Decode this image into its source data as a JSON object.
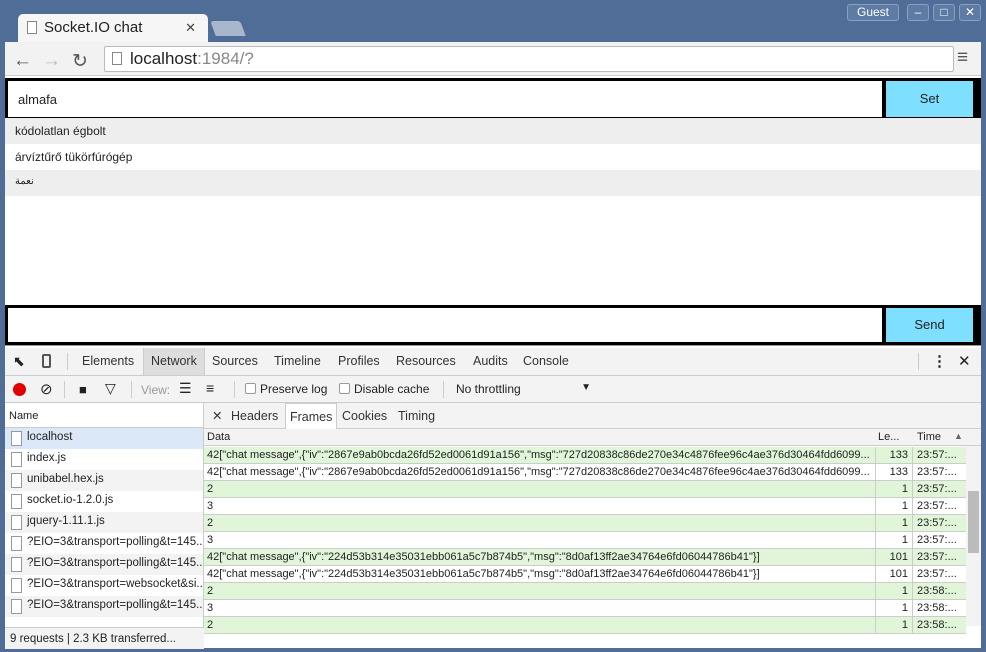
{
  "browser": {
    "tab_title": "Socket.IO chat",
    "profile": "Guest",
    "url_host": "localhost",
    "url_rest": ":1984/?"
  },
  "page": {
    "name_input": "almafa",
    "set_label": "Set",
    "send_label": "Send",
    "message_input": "",
    "messages": [
      "kódolatlan égbolt",
      "árvíztűrő tükörfúrógép",
      "نعمة"
    ]
  },
  "devtools": {
    "tabs": [
      "Elements",
      "Network",
      "Sources",
      "Timeline",
      "Profiles",
      "Resources",
      "Audits",
      "Console"
    ],
    "selected_tab": "Network",
    "view_label": "View:",
    "preserve_log": "Preserve log",
    "disable_cache": "Disable cache",
    "throttling": "No throttling",
    "name_header": "Name",
    "requests": [
      "localhost",
      "index.js",
      "unibabel.hex.js",
      "socket.io-1.2.0.js",
      "jquery-1.11.1.js",
      "?EIO=3&transport=polling&t=145...",
      "?EIO=3&transport=polling&t=145...",
      "?EIO=3&transport=websocket&si...",
      "?EIO=3&transport=polling&t=145..."
    ],
    "status": "9 requests  |  2.3 KB transferred...",
    "detail_tabs": [
      "Headers",
      "Frames",
      "Cookies",
      "Timing"
    ],
    "selected_detail_tab": "Frames",
    "frame_headers": {
      "data": "Data",
      "length": "Le...",
      "time": "Time"
    },
    "frames": [
      {
        "data": "42[\"chat message\",{\"iv\":\"2867e9ab0bcda26fd52ed0061d91a156\",\"msg\":\"727d20838c86de270e34c4876fee96c4ae376d30464fdd6099...",
        "length": "133",
        "time": "23:57:...",
        "sent": true
      },
      {
        "data": "42[\"chat message\",{\"iv\":\"2867e9ab0bcda26fd52ed0061d91a156\",\"msg\":\"727d20838c86de270e34c4876fee96c4ae376d30464fdd6099...",
        "length": "133",
        "time": "23:57:...",
        "sent": false
      },
      {
        "data": "2",
        "length": "1",
        "time": "23:57:...",
        "sent": true
      },
      {
        "data": "3",
        "length": "1",
        "time": "23:57:...",
        "sent": false
      },
      {
        "data": "2",
        "length": "1",
        "time": "23:57:...",
        "sent": true
      },
      {
        "data": "3",
        "length": "1",
        "time": "23:57:...",
        "sent": false
      },
      {
        "data": "42[\"chat message\",{\"iv\":\"224d53b314e35031ebb061a5c7b874b5\",\"msg\":\"8d0af13ff2ae34764e6fd06044786b41\"}]",
        "length": "101",
        "time": "23:57:...",
        "sent": true
      },
      {
        "data": "42[\"chat message\",{\"iv\":\"224d53b314e35031ebb061a5c7b874b5\",\"msg\":\"8d0af13ff2ae34764e6fd06044786b41\"}]",
        "length": "101",
        "time": "23:57:...",
        "sent": false
      },
      {
        "data": "2",
        "length": "1",
        "time": "23:58:...",
        "sent": true
      },
      {
        "data": "3",
        "length": "1",
        "time": "23:58:...",
        "sent": false
      },
      {
        "data": "2",
        "length": "1",
        "time": "23:58:...",
        "sent": true
      }
    ]
  },
  "colors": {
    "sent_frame": "#e1f5d9",
    "button": "#7fdfff",
    "record": "#e00000",
    "frame": "#4f6d96"
  }
}
